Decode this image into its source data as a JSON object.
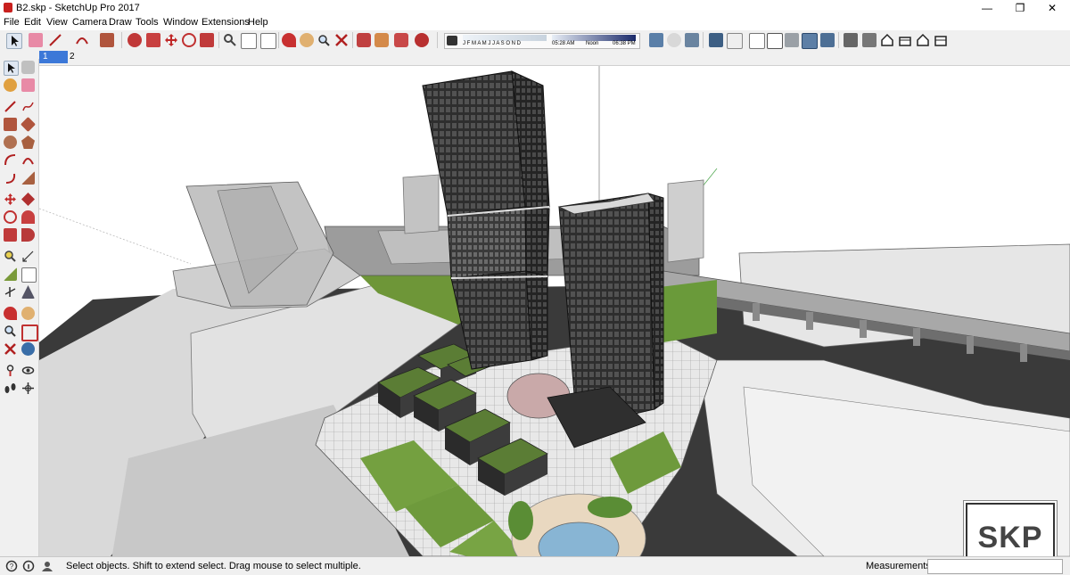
{
  "window": {
    "title": "B2.skp - SketchUp Pro 2017",
    "minimize": "—",
    "maximize": "❐",
    "close": "✕"
  },
  "menu": [
    "File",
    "Edit",
    "View",
    "Camera",
    "Draw",
    "Tools",
    "Window",
    "Extensions",
    "Help"
  ],
  "shadows": {
    "months": "J F M A M J J A S O N D",
    "time_start": "05:28 AM",
    "time_mid": "Noon",
    "time_end": "06:38 PM"
  },
  "scenes": [
    "1",
    "2"
  ],
  "status": {
    "message": "Select objects. Shift to extend select. Drag mouse to select multiple.",
    "measurements_label": "Measurements",
    "measurements_value": ""
  },
  "watermark": "SKP",
  "colors": {
    "accent_red": "#c8201e",
    "selected_tab": "#3c78d8",
    "roof_green": "#5b7d35",
    "glass": "#c9c9c9"
  }
}
